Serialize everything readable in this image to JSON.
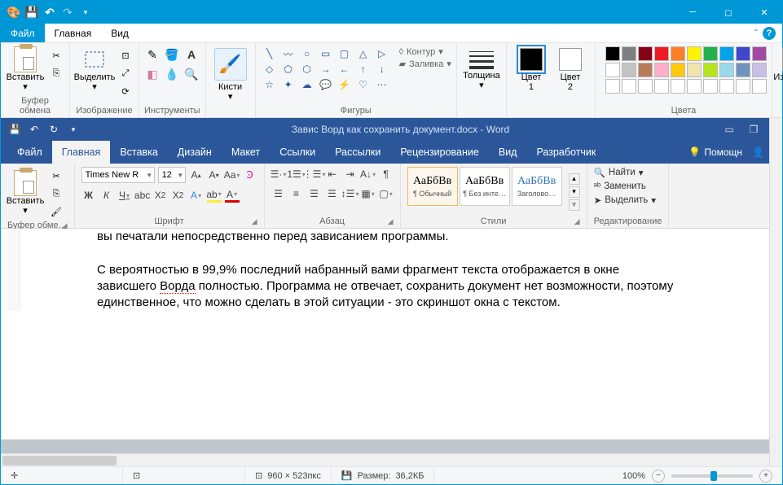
{
  "paint": {
    "tabs": {
      "file": "Файл",
      "home": "Главная",
      "view": "Вид"
    },
    "groups": {
      "clipboard": {
        "label": "Буфер обмена",
        "paste": "Вставить"
      },
      "image": {
        "label": "Изображение",
        "select": "Выделить"
      },
      "tools": {
        "label": "Инструменты"
      },
      "brush": {
        "label": "Кисти"
      },
      "shapes": {
        "label": "Фигуры",
        "outline": "Контур",
        "fill": "Заливка"
      },
      "thickness": {
        "label": "Толщина"
      },
      "color1": {
        "label": "Цвет\n1"
      },
      "color2": {
        "label": "Цвет\n2"
      },
      "colors": {
        "label": "Цвета"
      },
      "edit_colors": {
        "label": "Изменение\nцветов"
      }
    },
    "palette": [
      "#000000",
      "#7f7f7f",
      "#880015",
      "#ed1c24",
      "#ff7f27",
      "#fff200",
      "#22b14c",
      "#00a2e8",
      "#3f48cc",
      "#a349a4",
      "#ffffff",
      "#c3c3c3",
      "#b97a57",
      "#ffaec9",
      "#ffc90e",
      "#efe4b0",
      "#b5e61d",
      "#99d9ea",
      "#7092be",
      "#c8bfe7",
      "#ffffff",
      "#ffffff",
      "#ffffff",
      "#ffffff",
      "#ffffff",
      "#ffffff",
      "#ffffff",
      "#ffffff",
      "#ffffff",
      "#ffffff"
    ],
    "color1_value": "#000000",
    "color2_value": "#ffffff",
    "status": {
      "canvas_size": "960 × 523пкс",
      "file_size_label": "Размер:",
      "file_size": "36,2КБ",
      "zoom": "100%"
    }
  },
  "word": {
    "title": "Завис Ворд как сохранить документ.docx - Word",
    "tabs": {
      "file": "Файл",
      "home": "Главная",
      "insert": "Вставка",
      "design": "Дизайн",
      "layout": "Макет",
      "references": "Ссылки",
      "mailings": "Рассылки",
      "review": "Рецензирование",
      "view": "Вид",
      "developer": "Разработчик",
      "tell_me": "Помощн"
    },
    "clipboard": {
      "label": "Буфер обме…",
      "paste": "Вставить"
    },
    "font": {
      "label": "Шрифт",
      "name": "Times New R",
      "size": "12",
      "bold": "Ж",
      "italic": "К",
      "underline": "Ч"
    },
    "paragraph": {
      "label": "Абзац"
    },
    "styles": {
      "label": "Стили",
      "sample": "АаБбВв",
      "sample_blue": "АаБбВв",
      "normal": "¶ Обычный",
      "no_spacing": "¶ Без инте…",
      "heading1": "Заголово…"
    },
    "editing": {
      "label": "Редактирование",
      "find": "Найти",
      "replace": "Заменить",
      "select": "Выделить"
    },
    "doc": {
      "partial": "вы печатали непосредственно перед зависанием программы.",
      "para1_a": "С вероятностью в 99,9% последний набранный вами фрагмент текста отображается в окне зависшего ",
      "para1_err": "Ворда",
      "para1_b": " полностью. Программа не отвечает, сохранить документ нет возможности, поэтому единственное, что можно сделать в этой ситуации - это скриншот окна с текстом."
    }
  }
}
